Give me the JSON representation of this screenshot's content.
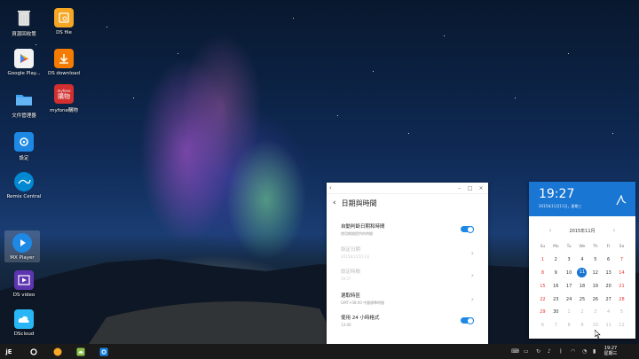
{
  "desktop": {
    "icons": [
      {
        "label": "資源回收筒",
        "icon": "recycle-bin-icon"
      },
      {
        "label": "DS file",
        "icon": "ds-file-icon"
      },
      {
        "label": "Google Play...",
        "icon": "google-play-icon"
      },
      {
        "label": "DS download",
        "icon": "ds-download-icon"
      },
      {
        "label": "文件管理器",
        "icon": "folder-icon"
      },
      {
        "label": "myfone購物",
        "icon": "myfone-icon",
        "badge": "購物",
        "brand": "myfone"
      },
      {
        "label": "設定",
        "icon": "settings-icon"
      },
      {
        "label": "Remix Central",
        "icon": "remix-central-icon"
      },
      {
        "label": "MX Player",
        "icon": "mx-player-icon"
      },
      {
        "label": "DS video",
        "icon": "ds-video-icon"
      },
      {
        "label": "DScloud",
        "icon": "ds-cloud-icon"
      }
    ]
  },
  "settings_window": {
    "back_glyph": "‹",
    "minimize": "–",
    "maximize": "□",
    "close": "×",
    "title": "日期與時間",
    "rows": [
      {
        "title": "自動判斷日期和時間",
        "subtitle": "使用網路提供的時間",
        "control": "toggle",
        "on": true
      },
      {
        "title": "設定日期",
        "subtitle": "2015年11月11日",
        "control": "chevron",
        "disabled": true
      },
      {
        "title": "設定時間",
        "subtitle": "19:27",
        "control": "chevron",
        "disabled": true
      },
      {
        "title": "選取時區",
        "subtitle": "GMT+08:00 中國標準時間",
        "control": "chevron"
      },
      {
        "title": "使用 24 小時格式",
        "subtitle": "13:00",
        "control": "toggle",
        "on": true
      }
    ]
  },
  "calendar": {
    "time": "19:27",
    "date": "2015年11月11日，星期三",
    "month_label": "2015年11月",
    "prev": "‹",
    "next": "›",
    "weekdays": [
      "Su",
      "Mo",
      "Tu",
      "We",
      "Th",
      "Fr",
      "Sa"
    ],
    "weeks": [
      [
        "1",
        "2",
        "3",
        "4",
        "5",
        "6",
        "7"
      ],
      [
        "8",
        "9",
        "10",
        "11",
        "12",
        "13",
        "14"
      ],
      [
        "15",
        "16",
        "17",
        "18",
        "19",
        "20",
        "21"
      ],
      [
        "22",
        "23",
        "24",
        "25",
        "26",
        "27",
        "28"
      ],
      [
        "29",
        "30",
        "1",
        "2",
        "3",
        "4",
        "5"
      ],
      [
        "6",
        "7",
        "8",
        "9",
        "10",
        "11",
        "12"
      ]
    ],
    "today": "11",
    "accent": "#1976d2",
    "weekend_color": "#e53935"
  },
  "taskbar": {
    "start_label": "jide-start-icon",
    "apps": [
      "circle-menu-icon",
      "coin-app-icon",
      "android-app-icon",
      "settings-app-icon"
    ],
    "tray": [
      "keyboard-icon",
      "screen-icon",
      "refresh-icon",
      "volume-icon",
      "bluetooth-icon",
      "headset-icon",
      "wifi-icon",
      "battery-icon"
    ],
    "clock_time": "19:27",
    "clock_day": "星期三"
  },
  "colors": {
    "accent": "#1976d2",
    "taskbar": "#1a1a1a"
  }
}
